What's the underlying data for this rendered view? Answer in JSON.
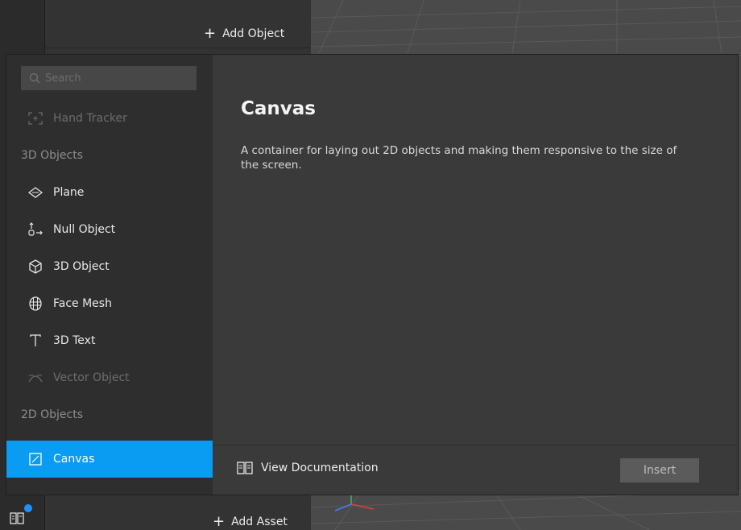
{
  "background": {
    "add_object_label": "Add Object",
    "add_asset_label": "Add Asset"
  },
  "dialog": {
    "search": {
      "placeholder": "Search",
      "value": ""
    },
    "sidebar": [
      {
        "type": "item",
        "label": "Hand Tracker",
        "icon": "hand-tracker-icon",
        "disabled": true
      },
      {
        "type": "section",
        "label": "3D Objects"
      },
      {
        "type": "item",
        "label": "Plane",
        "icon": "plane-icon"
      },
      {
        "type": "item",
        "label": "Null Object",
        "icon": "null-object-icon"
      },
      {
        "type": "item",
        "label": "3D Object",
        "icon": "cube-icon"
      },
      {
        "type": "item",
        "label": "Face Mesh",
        "icon": "face-mesh-icon"
      },
      {
        "type": "item",
        "label": "3D Text",
        "icon": "text-icon"
      },
      {
        "type": "item",
        "label": "Vector Object",
        "icon": "vector-object-icon",
        "disabled": true
      },
      {
        "type": "section",
        "label": "2D Objects"
      },
      {
        "type": "item",
        "label": "Canvas",
        "icon": "canvas-icon",
        "selected": true
      }
    ],
    "detail": {
      "title": "Canvas",
      "description": "A container for laying out 2D objects and making them responsive to the size of the screen."
    },
    "footer": {
      "view_documentation_label": "View Documentation",
      "insert_label": "Insert"
    }
  },
  "colors": {
    "selection": "#0a9cf2",
    "dialog_bg": "#3a3a3a",
    "sidebar_bg": "#2e2e2e",
    "notification_dot": "#1e90ff"
  }
}
